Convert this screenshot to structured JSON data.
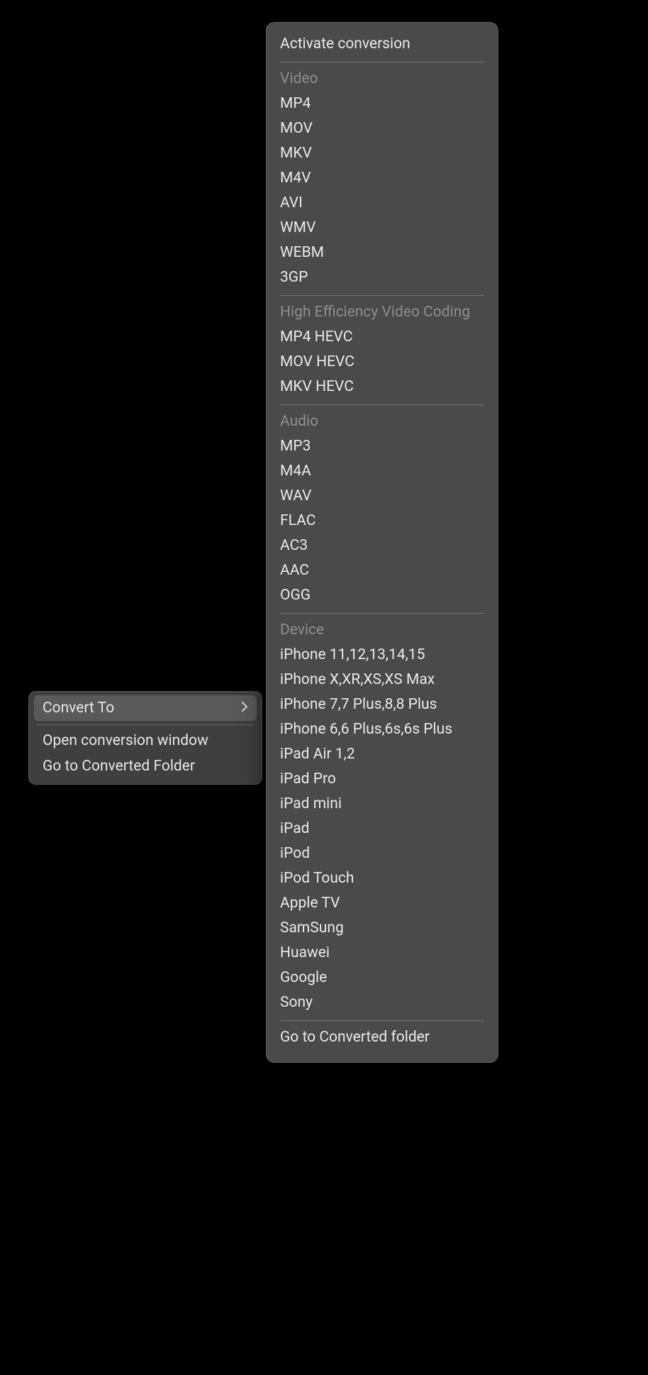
{
  "parent_menu": {
    "items": [
      {
        "label": "Convert To",
        "has_submenu": true,
        "highlighted": true
      },
      {
        "label": "Open conversion window",
        "has_submenu": false,
        "highlighted": false
      },
      {
        "label": "Go to Converted Folder",
        "has_submenu": false,
        "highlighted": false
      }
    ]
  },
  "sub_menu": {
    "top_item": "Activate conversion",
    "sections": [
      {
        "title": "Video",
        "items": [
          "MP4",
          "MOV",
          "MKV",
          "M4V",
          "AVI",
          "WMV",
          "WEBM",
          "3GP"
        ]
      },
      {
        "title": "High Efficiency Video Coding",
        "items": [
          "MP4 HEVC",
          "MOV HEVC",
          "MKV HEVC"
        ]
      },
      {
        "title": "Audio",
        "items": [
          "MP3",
          "M4A",
          "WAV",
          "FLAC",
          "AC3",
          "AAC",
          "OGG"
        ]
      },
      {
        "title": "Device",
        "items": [
          "iPhone 11,12,13,14,15",
          "iPhone X,XR,XS,XS Max",
          "iPhone 7,7 Plus,8,8 Plus",
          "iPhone 6,6 Plus,6s,6s Plus",
          "iPad Air 1,2",
          "iPad Pro",
          "iPad mini",
          "iPad",
          "iPod",
          "iPod Touch",
          "Apple TV",
          "SamSung",
          "Huawei",
          "Google",
          "Sony"
        ]
      }
    ],
    "bottom_item": "Go to Converted folder"
  }
}
